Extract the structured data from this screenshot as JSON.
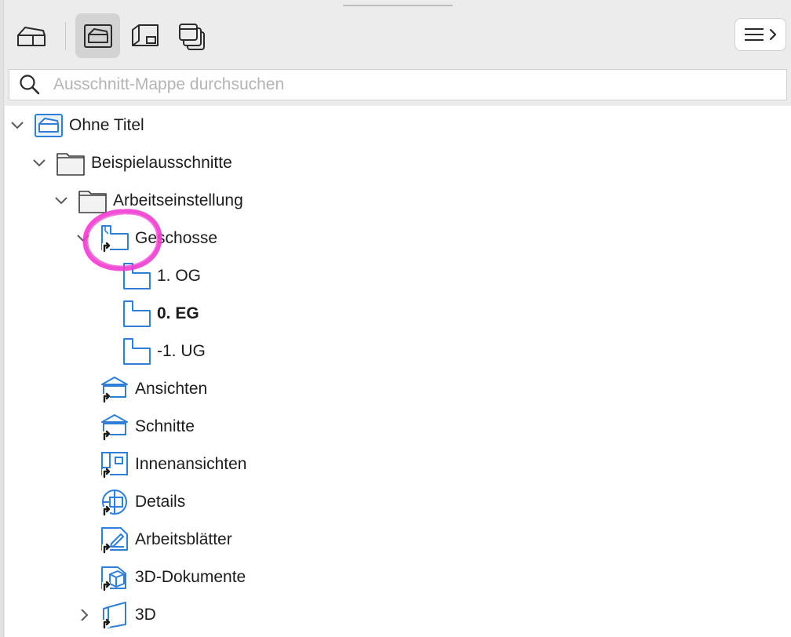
{
  "toolbar": {
    "buttons": [
      {
        "name": "project-map",
        "icon": "house-outline-icon",
        "active": false
      },
      {
        "name": "view-map",
        "icon": "view-map-icon",
        "active": true
      },
      {
        "name": "layout-book",
        "icon": "layout-book-icon",
        "active": false
      },
      {
        "name": "publisher-sets",
        "icon": "publisher-stack-icon",
        "active": false
      }
    ],
    "menu_icon": "hamburger-chevron-icon"
  },
  "search": {
    "placeholder": "Ausschnitt-Mappe durchsuchen",
    "value": ""
  },
  "tree": {
    "root": {
      "label": "Ohne Titel",
      "expanded": true,
      "icon": "project-house-icon"
    },
    "folder1": {
      "label": "Beispielausschnitte",
      "expanded": true,
      "icon": "folder-icon"
    },
    "folder2": {
      "label": "Arbeitseinstellung",
      "expanded": true,
      "icon": "folder-icon"
    },
    "geschosse": {
      "label": "Geschosse",
      "expanded": true,
      "icon": "story-shortcut-icon"
    },
    "stories": [
      {
        "label": "1. OG",
        "bold": false,
        "icon": "story-icon"
      },
      {
        "label": "0. EG",
        "bold": true,
        "icon": "story-icon"
      },
      {
        "label": "-1. UG",
        "bold": false,
        "icon": "story-icon"
      }
    ],
    "items": [
      {
        "label": "Ansichten",
        "icon": "elevation-shortcut-icon"
      },
      {
        "label": "Schnitte",
        "icon": "section-shortcut-icon"
      },
      {
        "label": "Innenansichten",
        "icon": "interior-elevation-shortcut-icon"
      },
      {
        "label": "Details",
        "icon": "detail-shortcut-icon"
      },
      {
        "label": "Arbeitsblätter",
        "icon": "worksheet-shortcut-icon"
      },
      {
        "label": "3D-Dokumente",
        "icon": "3d-document-shortcut-icon"
      },
      {
        "label": "3D",
        "icon": "3d-shortcut-icon",
        "expanded": false
      }
    ]
  },
  "colors": {
    "accent": "#2f7fd9",
    "highlight": "#f03cd2"
  }
}
